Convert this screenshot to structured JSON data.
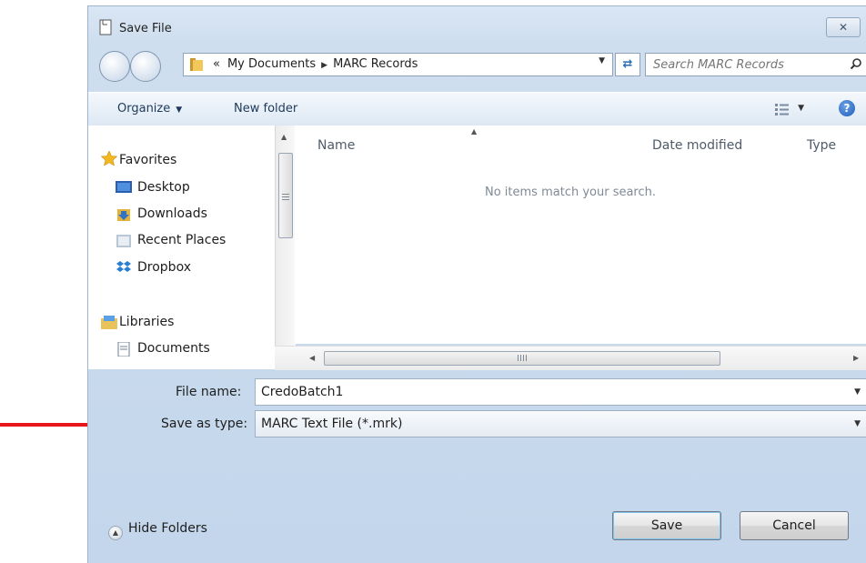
{
  "window": {
    "title": "Save File",
    "close_glyph": "✕"
  },
  "address": {
    "crumbs": [
      "«",
      "My Documents",
      "MARC Records"
    ],
    "separator": "▶",
    "dropdown_glyph": "▼"
  },
  "search": {
    "placeholder": "Search MARC Records"
  },
  "toolbar": {
    "organize_label": "Organize",
    "new_folder_label": "New folder",
    "caret": "▼",
    "help_glyph": "?"
  },
  "nav": {
    "favorites_header": "Favorites",
    "favorites": [
      "Desktop",
      "Downloads",
      "Recent Places",
      "Dropbox"
    ],
    "libraries_header": "Libraries",
    "libraries": [
      "Documents"
    ]
  },
  "file_list": {
    "columns": [
      "Name",
      "Date modified",
      "Type"
    ],
    "empty_message": "No items match your search."
  },
  "form": {
    "file_name_label": "File name:",
    "file_name_value": "CredoBatch1",
    "save_type_label": "Save as type:",
    "save_type_value": "MARC Text File (*.mrk)"
  },
  "footer": {
    "hide_folders_label": "Hide Folders",
    "save_label": "Save",
    "cancel_label": "Cancel"
  },
  "colors": {
    "annotation_arrow": "#e8151b",
    "accent": "#2a6bb7"
  }
}
